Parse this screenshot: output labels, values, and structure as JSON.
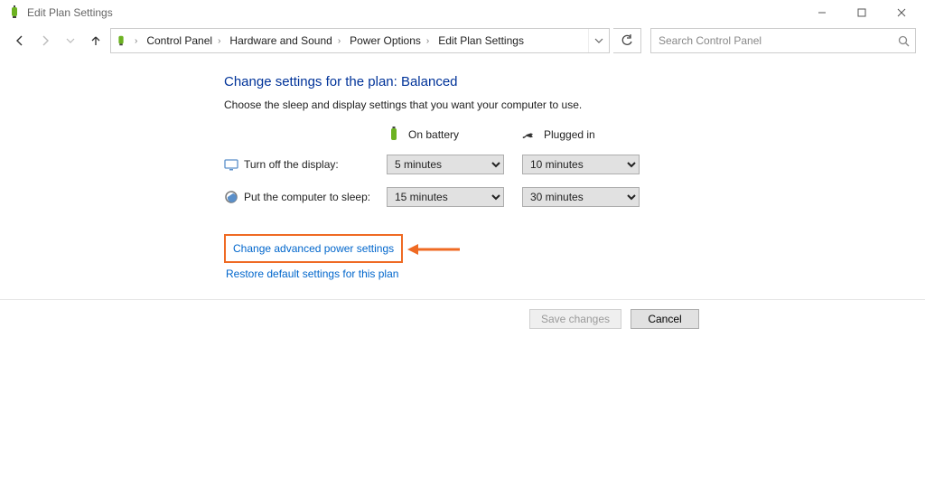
{
  "window": {
    "title": "Edit Plan Settings"
  },
  "breadcrumbs": {
    "b0": "Control Panel",
    "b1": "Hardware and Sound",
    "b2": "Power Options",
    "b3": "Edit Plan Settings"
  },
  "search": {
    "placeholder": "Search Control Panel"
  },
  "heading": "Change settings for the plan: Balanced",
  "subtext": "Choose the sleep and display settings that you want your computer to use.",
  "columns": {
    "battery": "On battery",
    "plugged": "Plugged in"
  },
  "rows": {
    "display": {
      "label": "Turn off the display:",
      "battery": "5 minutes",
      "plugged": "10 minutes"
    },
    "sleep": {
      "label": "Put the computer to sleep:",
      "battery": "15 minutes",
      "plugged": "30 minutes"
    }
  },
  "links": {
    "advanced": "Change advanced power settings",
    "restore": "Restore default settings for this plan"
  },
  "buttons": {
    "save": "Save changes",
    "cancel": "Cancel"
  }
}
